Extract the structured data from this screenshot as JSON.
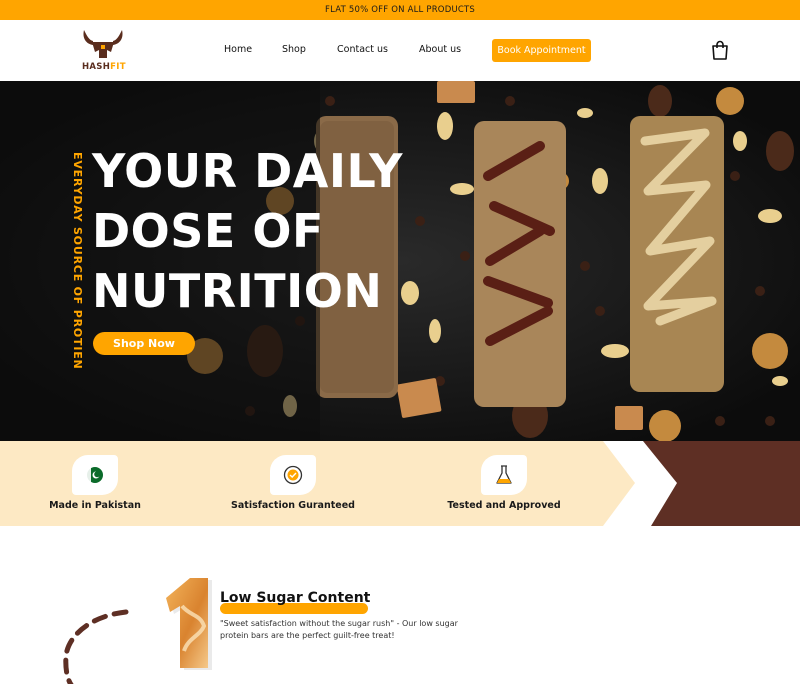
{
  "announcement": "FLAT 50% OFF ON ALL PRODUCTS",
  "brand": {
    "name_part1": "HASH",
    "name_part2": "FIT"
  },
  "nav": {
    "links": [
      "Home",
      "Shop",
      "Contact us",
      "About us"
    ],
    "cta": "Book Appointment",
    "cart_icon": "shopping-bag-icon"
  },
  "hero": {
    "vertical_text": "EVERYDAY SOURCE OF PROTIEN",
    "headline_lines": [
      "YOUR DAILY",
      "DOSE OF",
      "NUTRITION"
    ],
    "cta": "Shop Now"
  },
  "features": [
    {
      "label": "Made in Pakistan",
      "icon": "pakistan-flag-icon"
    },
    {
      "label": "Satisfaction Guranteed",
      "icon": "satisfaction-badge-icon"
    },
    {
      "label": "Tested and Approved",
      "icon": "flask-icon"
    }
  ],
  "highlight": {
    "number": "1",
    "title": "Low Sugar Content",
    "description": "\"Sweet satisfaction without the sugar rush\" - Our low sugar protein bars are the perfect guilt-free treat!"
  },
  "colors": {
    "accent": "#ffa500",
    "brown": "#5e2f24",
    "cream": "#fde9c4"
  }
}
